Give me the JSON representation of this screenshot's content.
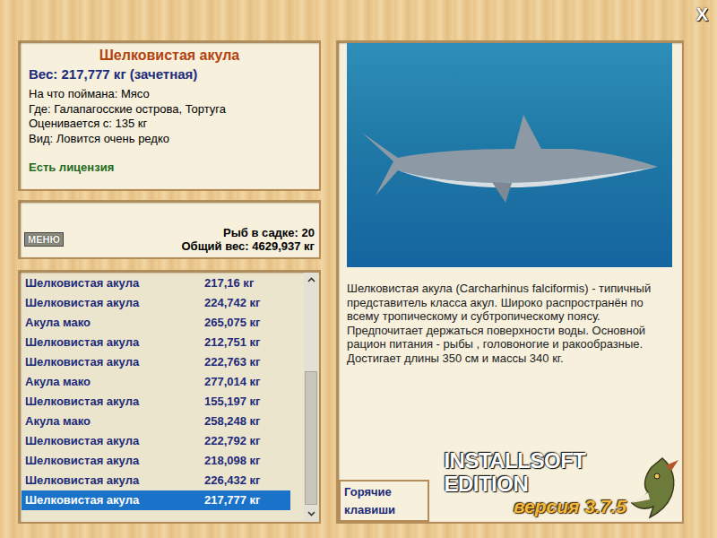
{
  "close": "X",
  "fish": {
    "title": "Шелковистая акула",
    "weight": "Вес: 217,777 кг (зачетная)",
    "details": [
      "На что поймана: Мясо",
      "Где: Галапагосские острова, Тортуга",
      "Оценивается с: 135 кг",
      "Вид: Ловится очень редко"
    ],
    "license": "Есть лицензия"
  },
  "menu_button": "МЕНЮ",
  "keepnet": {
    "count": "Рыб в садке: 20",
    "total": "Общий вес: 4629,937 кг"
  },
  "catch_list": [
    {
      "name": "Шелковистая акула",
      "weight": "217,16 кг",
      "selected": false
    },
    {
      "name": "Шелковистая акула",
      "weight": "224,742 кг",
      "selected": false
    },
    {
      "name": "Акула мако",
      "weight": "265,075 кг",
      "selected": false
    },
    {
      "name": "Шелковистая акула",
      "weight": "212,751 кг",
      "selected": false
    },
    {
      "name": "Шелковистая акула",
      "weight": "222,763 кг",
      "selected": false
    },
    {
      "name": "Акула мако",
      "weight": "277,014 кг",
      "selected": false
    },
    {
      "name": "Шелковистая акула",
      "weight": "155,197 кг",
      "selected": false
    },
    {
      "name": "Акула мако",
      "weight": "258,248 кг",
      "selected": false
    },
    {
      "name": "Шелковистая акула",
      "weight": "222,792 кг",
      "selected": false
    },
    {
      "name": "Шелковистая акула",
      "weight": "218,098 кг",
      "selected": false
    },
    {
      "name": "Шелковистая акула",
      "weight": "226,432 кг",
      "selected": false
    },
    {
      "name": "Шелковистая акула",
      "weight": "217,777 кг",
      "selected": true
    }
  ],
  "description": "Шелковистая акула (Carcharhinus falciformis) - типичный представитель класса акул. Широко распространён по всему тропическому и субтропическому поясу. Предпочитает держаться поверхности воды. Основной рацион питания - рыбы , головоногие и ракообразные. Достигает длины 350 см и массы 340 кг.",
  "hotkeys_button": "Горячие клавиши",
  "logo": {
    "title": "INSTALLSOFT EDITION",
    "version": "версия 3.7.5"
  }
}
